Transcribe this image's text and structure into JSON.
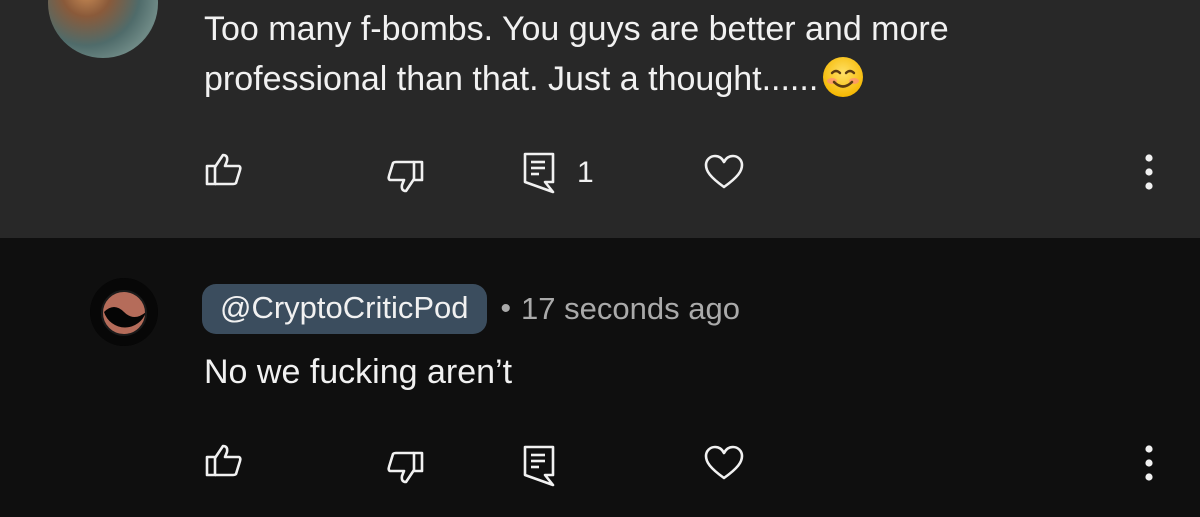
{
  "comments": [
    {
      "text_line1": "Too many f-bombs.  You guys are better and more",
      "text_line2": "professional than that.  Just a thought......",
      "reply_count": "1"
    },
    {
      "handle": "@CryptoCriticPod",
      "separator": "•",
      "timestamp": "17 seconds ago",
      "text": "No we fucking aren’t"
    }
  ],
  "colors": {
    "top_background": "#282828",
    "bottom_background": "#0f0f0f",
    "handle_pill": "#3b4d5e",
    "muted_text": "#aaaaaa"
  },
  "icons": [
    "like-icon",
    "dislike-icon",
    "reply-icon",
    "heart-icon",
    "more-icon",
    "smiling-face-emoji"
  ]
}
